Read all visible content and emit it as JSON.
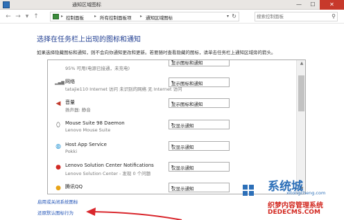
{
  "window": {
    "title": "通知区域图标",
    "min_glyph": "—",
    "max_glyph": "☐",
    "close_glyph": "✕"
  },
  "address": {
    "back_glyph": "←",
    "forward_glyph": "→",
    "history_glyph": "▾",
    "up_glyph": "↑",
    "crumbs": [
      "控制面板",
      "所有控制面板项",
      "通知区域图标"
    ],
    "sep_glyph": "▸",
    "dropdown_glyph": "▾",
    "refresh_glyph": "↻"
  },
  "search": {
    "placeholder": "搜索控制面板",
    "icon_glyph": "⚲"
  },
  "heading": "选择在任务栏上出现的图标和通知",
  "description": "如果选择隐藏图标和通知，则不会向你通知更改和更新。若要随时查看隐藏的图标，请单击任务栏上通知区域旁的箭头。",
  "items": [
    {
      "name": "",
      "sub": "95% 可用(电源已接通，未充电)",
      "behavior": "显示图标和通知",
      "icon": "battery-icon",
      "glyph": ""
    },
    {
      "name": "网络",
      "sub": "tatajie110 Internet 访问  未识别的网络 无 Internet 访问",
      "behavior": "显示图标和通知",
      "icon": "network-icon",
      "glyph": "▂▄▆"
    },
    {
      "name": "音量",
      "sub": "扬声器: 静音",
      "behavior": "显示图标和通知",
      "icon": "volume-muted-icon",
      "glyph": "◀"
    },
    {
      "name": "Mouse Suite 98 Daemon",
      "sub": "Lenovo Mouse Suite",
      "behavior": "仅显示通知",
      "icon": "mouse-icon",
      "glyph": "⬯"
    },
    {
      "name": "Host App Service",
      "sub": "Pokki",
      "behavior": "仅显示通知",
      "icon": "pokki-icon",
      "glyph": "◍"
    },
    {
      "name": "Lenovo Solution Center Notifications",
      "sub": "Lenovo Solution Center - 发现 0 个问题",
      "behavior": "仅显示通知",
      "icon": "lenovo-solution-center-icon",
      "glyph": "●"
    },
    {
      "name": "腾讯QQ",
      "sub": "",
      "behavior": "仅显示通知",
      "icon": "qq-penguin-icon",
      "glyph": "●"
    }
  ],
  "select_arrow": "▾",
  "scroll": {
    "up_glyph": "▲",
    "down_glyph": "▼"
  },
  "links": {
    "system_icons": "启用或关闭系统图标",
    "restore_defaults": "还原默认图标行为"
  },
  "watermark": {
    "brand": "系统城",
    "domain": "xitongcheng.com",
    "site_name": "织梦内容管理系统",
    "site_url": "DEDECMS.COM"
  },
  "colors": {
    "heading": "#1f3d91",
    "link": "#2355b7",
    "annotation_arrow": "#d9262c",
    "close_button": "#c7392b",
    "watermark_blue": "#2c6fb8",
    "watermark_red": "#d2271f"
  }
}
